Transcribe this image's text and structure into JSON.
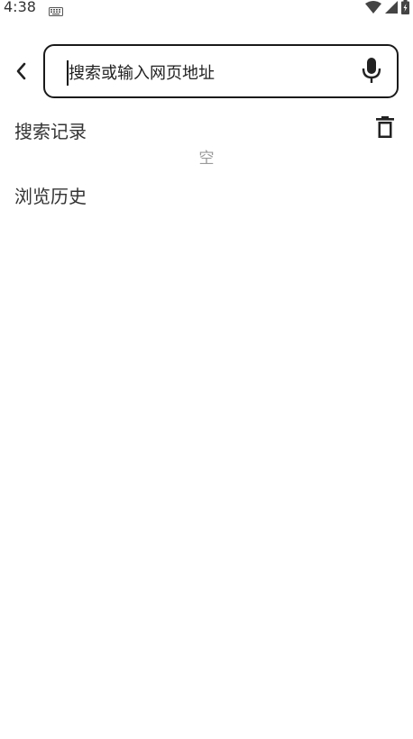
{
  "status_bar": {
    "time": "4:38",
    "icons": [
      "keyboard-icon",
      "wifi-icon",
      "signal-icon",
      "battery-charging-icon"
    ]
  },
  "search": {
    "placeholder": "搜索或输入网页地址",
    "value": ""
  },
  "search_history": {
    "title": "搜索记录",
    "empty_label": "空"
  },
  "browse_history": {
    "title": "浏览历史"
  },
  "colors": {
    "background": "#ffffff",
    "text": "#333333",
    "muted": "#9a9a9a",
    "border": "#1a1a1a"
  }
}
